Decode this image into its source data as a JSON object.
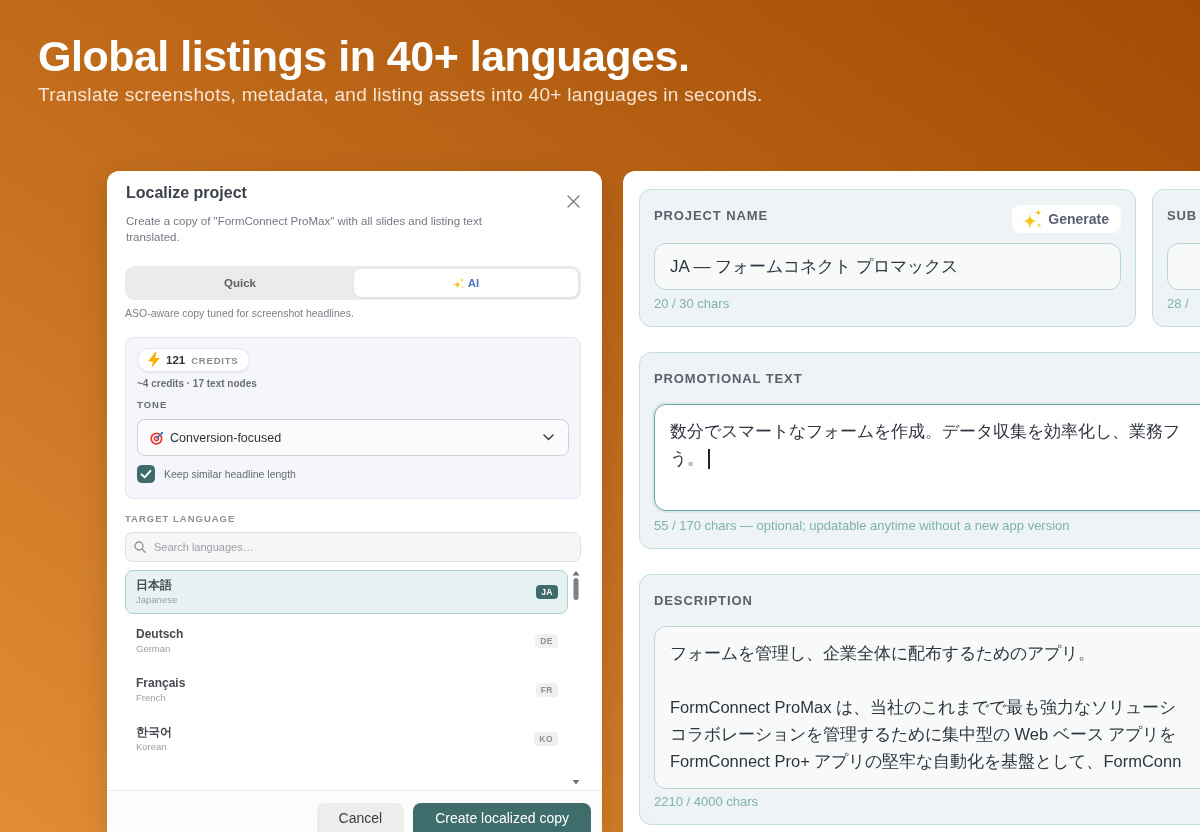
{
  "hero": {
    "title": "Global listings in 40+ languages.",
    "subtitle": "Translate screenshots, metadata, and listing assets into 40+ languages in seconds."
  },
  "dialog": {
    "title": "Localize project",
    "description": "Create a copy of \"FormConnect ProMax\" with all slides and listing text translated.",
    "modes": [
      {
        "label": "Quick",
        "kind": "plain",
        "selected": false
      },
      {
        "label": "AI",
        "kind": "ai",
        "selected": true
      }
    ],
    "mode_hint": "ASO-aware copy tuned for screenshot headlines.",
    "ai_options": {
      "credits": {
        "count": "121",
        "label": "CREDITS"
      },
      "estimate": "~4 credits · 17 text nodes",
      "tone": {
        "label": "TONE",
        "value": "Conversion-focused"
      },
      "keep_length": {
        "label": "Keep similar headline length",
        "checked": true
      }
    },
    "target_language": {
      "label": "TARGET LANGUAGE",
      "search": {
        "placeholder": "Search languages…"
      },
      "languages": [
        {
          "native": "日本語",
          "english": "Japanese",
          "code": "JA",
          "selected": true
        },
        {
          "native": "Deutsch",
          "english": "German",
          "code": "DE",
          "selected": false
        },
        {
          "native": "Français",
          "english": "French",
          "code": "FR",
          "selected": false
        },
        {
          "native": "한국어",
          "english": "Korean",
          "code": "KO",
          "selected": false
        }
      ]
    },
    "buttons": [
      {
        "label": "Cancel",
        "kind": "secondary"
      },
      {
        "label": "Create localized copy",
        "kind": "primary"
      }
    ]
  },
  "listing_editor": {
    "top_fields": [
      {
        "label": "PROJECT NAME",
        "action": "Generate",
        "value": "JA — フォームコネクト プロマックス",
        "counter": "20 / 30 chars"
      },
      {
        "label": "SUB",
        "counter": "28 /"
      }
    ],
    "promotional_text": {
      "label": "PROMOTIONAL TEXT",
      "focused": true,
      "lines": [
        "数分でスマートなフォームを作成。データ収集を効率化し、業務フ",
        "う。"
      ],
      "counter": "55 / 170 chars — optional; updatable anytime without a new app version"
    },
    "description": {
      "label": "DESCRIPTION",
      "focused": false,
      "paragraphs": [
        [
          "フォームを管理し、企業全体に配布するためのアプリ。"
        ],
        [
          "FormConnect ProMax は、当社のこれまでで最も強力なソリューシ",
          "コラボレーションを管理するために集中型の Web ベース アプリを",
          "FormConnect Pro+ アプリの堅牢な自動化を基盤として、FormConn"
        ]
      ],
      "counter": "2210 / 4000 chars"
    }
  }
}
